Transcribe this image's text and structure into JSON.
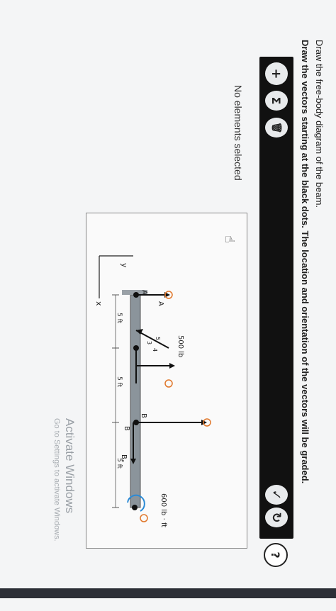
{
  "instructions": {
    "line1": "Draw the free-body diagram of the beam.",
    "line2": "Draw the vectors starting at the black dots. The location and orientation of the vectors will be graded."
  },
  "toolbar": {
    "add_label": "+",
    "sigma_label": "Σ",
    "trash_label": "🗑",
    "check_label": "✓",
    "reset_label": "↻",
    "help_label": "?"
  },
  "status": {
    "text": "No elements selected"
  },
  "diagram": {
    "load_label": "500 lb",
    "ratio_3": "3",
    "ratio_4": "4",
    "ratio_5": "5",
    "moment_label": "600 lb · ft",
    "point_a": "A",
    "point_b": "B",
    "label_ay": "A",
    "label_by": "B",
    "label_bx": "Bₓ",
    "axis_y": "y",
    "axis_x": "x",
    "dim1": "5 ft",
    "dim2": "5 ft",
    "dim3": "5 ft"
  },
  "watermark": {
    "title": "Activate Windows",
    "subtitle": "Go to Settings to activate Windows."
  }
}
